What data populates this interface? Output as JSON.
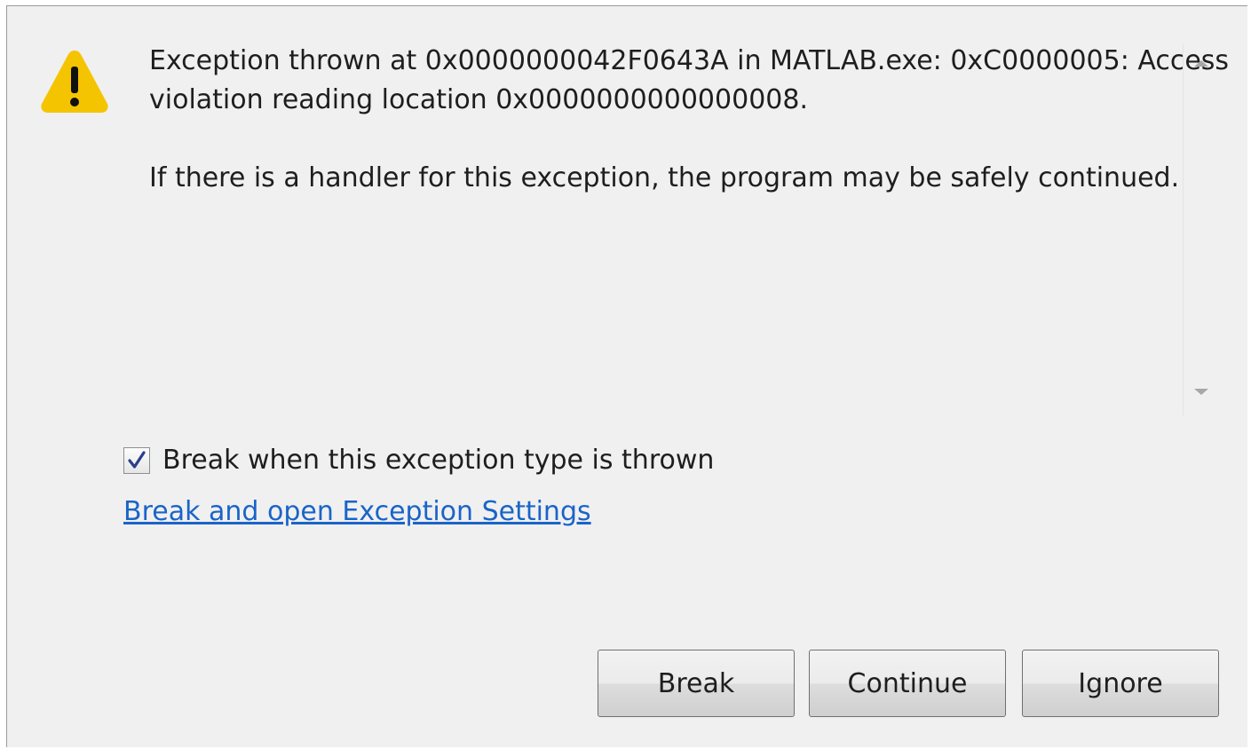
{
  "icon": "warning-triangle-icon",
  "message": {
    "line1": "Exception thrown at 0x0000000042F0643A in MATLAB.exe: 0xC0000005: Access",
    "line2": "violation reading location 0x0000000000000008.",
    "line3": "If there is a handler for this exception, the program may be safely continued."
  },
  "checkbox": {
    "label": "Break when this exception type is thrown",
    "checked": true
  },
  "link": {
    "label": "Break and open Exception Settings"
  },
  "buttons": {
    "break_label": "Break",
    "continue_label": "Continue",
    "ignore_label": "Ignore"
  },
  "colors": {
    "warning": "#f5c400",
    "link": "#1a64c8",
    "background": "#f0f0f0"
  }
}
